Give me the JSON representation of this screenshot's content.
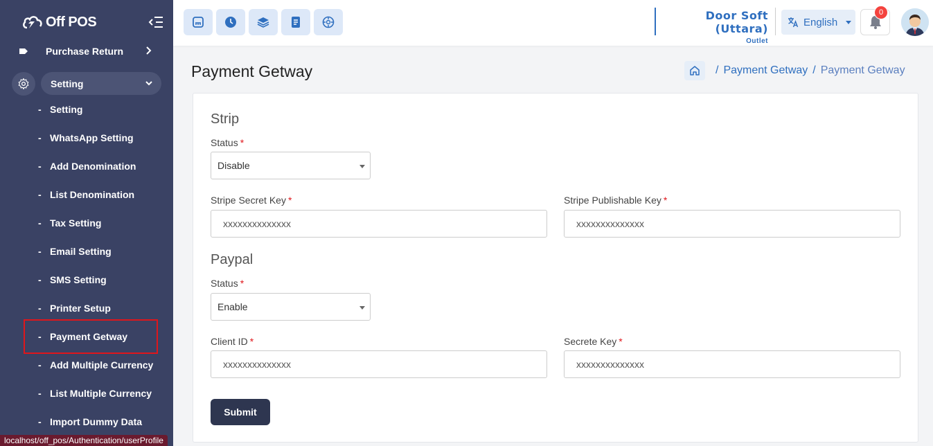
{
  "app": {
    "logo_text": "Off POS"
  },
  "sidebar": {
    "purchase_return": "Purchase Return",
    "setting_group": "Setting",
    "items": [
      {
        "label": "Setting"
      },
      {
        "label": "WhatsApp Setting"
      },
      {
        "label": "Add Denomination"
      },
      {
        "label": "List Denomination"
      },
      {
        "label": "Tax Setting"
      },
      {
        "label": "Email Setting"
      },
      {
        "label": "SMS Setting"
      },
      {
        "label": "Printer Setup"
      },
      {
        "label": "Payment Getway",
        "active": true
      },
      {
        "label": "Add Multiple Currency"
      },
      {
        "label": "List Multiple Currency"
      },
      {
        "label": "Import Dummy Data"
      }
    ],
    "dash": "-"
  },
  "status_bar": {
    "url": "localhost/off_pos/Authentication/userProfile"
  },
  "header": {
    "quick_buttons": [
      "pos-icon",
      "clock-icon",
      "layers-icon",
      "document-icon",
      "dashboard-icon"
    ],
    "outlet_name": "Door Soft (Uttara)",
    "outlet_label": "Outlet",
    "language": "English",
    "notification_count": "0"
  },
  "page": {
    "title": "Payment Getway",
    "breadcrumb": [
      "Payment Getway",
      "Payment Getway"
    ],
    "separator": "/"
  },
  "form": {
    "strip": {
      "title": "Strip",
      "status_label": "Status",
      "status_value": "Disable",
      "secret_key_label": "Stripe Secret Key",
      "secret_key_value": "xxxxxxxxxxxxxx",
      "publishable_key_label": "Stripe Publishable Key",
      "publishable_key_value": "xxxxxxxxxxxxxx"
    },
    "paypal": {
      "title": "Paypal",
      "status_label": "Status",
      "status_value": "Enable",
      "client_id_label": "Client ID",
      "client_id_value": "xxxxxxxxxxxxxx",
      "secret_key_label": "Secrete Key",
      "secret_key_value": "xxxxxxxxxxxxxx"
    },
    "required_mark": "*",
    "submit_label": "Submit"
  },
  "colors": {
    "sidebar": "#3a4264",
    "accent": "#2f6fbf",
    "required": "#e0161b",
    "button": "#2e3650",
    "badge": "#f4433e"
  }
}
